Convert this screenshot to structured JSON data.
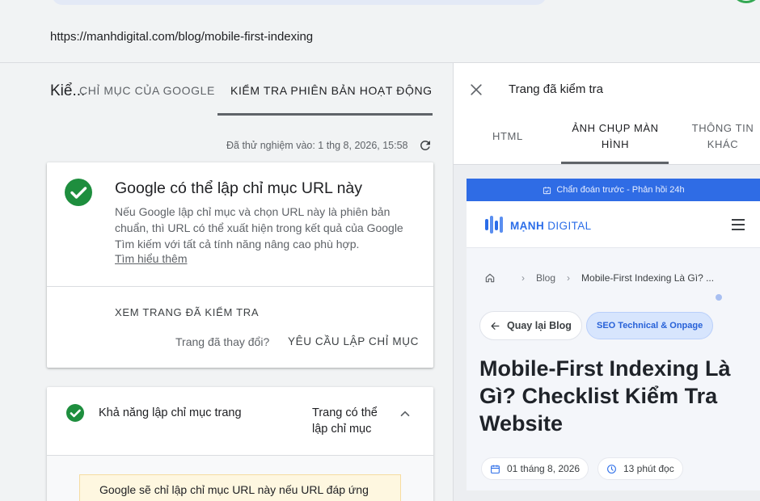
{
  "url": "https://manhdigital.com/blog/mobile-first-indexing",
  "colors": {
    "accent": "#2f6ce5",
    "success": "#1e8e3e",
    "warning_bg": "#fef7e0"
  },
  "left_tabs": {
    "title": "Kiể...",
    "google_index": "CHỈ MỤC CỦA GOOGLE",
    "live_test": "KIỂM TRA PHIÊN BẢN HOẠT ĐỘNG"
  },
  "tested_at": "Đã thử nghiệm vào: 1 thg 8, 2026, 15:58",
  "result_card": {
    "title": "Google có thể lập chỉ mục URL này",
    "description": "Nếu Google lập chỉ mục và chọn URL này là phiên bản chuẩn, thì URL có thể xuất hiện trong kết quả của Google Tìm kiếm với tất cả tính năng nâng cao phù hợp.",
    "learn_more": "Tìm hiểu thêm",
    "view_tested": "XEM TRANG ĐÃ KIỂM TRA",
    "changed_question": "Trang đã thay đổi?",
    "request_indexing": "YÊU CẦU LẬP CHỈ MỤC"
  },
  "index_card": {
    "label": "Khả năng lập chỉ mục trang",
    "status": "Trang có thể lập chỉ mục",
    "warning": "Google sẽ chỉ lập chỉ mục URL này nếu URL đáp ứng"
  },
  "panel": {
    "title": "Trang đã kiểm tra",
    "tabs": {
      "html": "HTML",
      "screenshot": "ẢNH CHỤP MÀN HÌNH",
      "more_info": "THÔNG TIN KHÁC"
    }
  },
  "screenshot": {
    "promo": "Chẩn đoán trước - Phản hồi 24h",
    "logo_bold": "MẠNH",
    "logo_rest": " DIGITAL",
    "crumb_blog": "Blog",
    "crumb_current": "Mobile-First Indexing Là Gì? ...",
    "back_label": "Quay lại Blog",
    "tag": "SEO Technical & Onpage",
    "article_title": "Mobile-First Indexing Là Gì? Checklist Kiểm Tra Website",
    "date": "01 tháng 8, 2026",
    "read_time": "13 phút đọc"
  }
}
